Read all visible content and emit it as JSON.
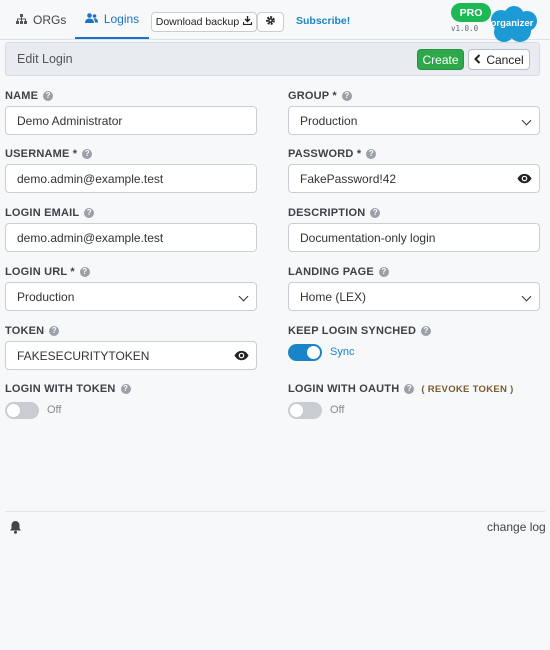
{
  "nav": {
    "tabs": [
      {
        "label": "ORGs",
        "icon": "sitemap-icon"
      },
      {
        "label": "Logins",
        "icon": "users-icon",
        "active": true
      }
    ],
    "download_backup_label": "Download backup",
    "subscribe_label": "Subscribe!",
    "pro_label": "PRO",
    "version": "v1.0.0",
    "logo_text": "organizer"
  },
  "header": {
    "title": "Edit Login",
    "create_label": "Create",
    "cancel_label": "Cancel"
  },
  "form": {
    "name": {
      "label": "NAME",
      "value": "Demo Administrator"
    },
    "group": {
      "label": "GROUP *",
      "value": "Production"
    },
    "username": {
      "label": "USERNAME *",
      "value": "demo.admin@example.test"
    },
    "password": {
      "label": "PASSWORD *",
      "value": "FakePassword!42"
    },
    "login_email": {
      "label": "LOGIN EMAIL",
      "value": "demo.admin@example.test"
    },
    "description": {
      "label": "DESCRIPTION",
      "value": "Documentation-only login"
    },
    "login_url": {
      "label": "LOGIN URL *",
      "value": "Production"
    },
    "landing_page": {
      "label": "LANDING PAGE",
      "value": "Home (LEX)"
    },
    "token": {
      "label": "TOKEN",
      "value": "FAKESECURITYTOKEN"
    },
    "keep_synched": {
      "label": "KEEP LOGIN SYNCHED",
      "state": "Sync",
      "on": true
    },
    "login_with_token": {
      "label": "LOGIN WITH TOKEN",
      "state": "Off",
      "on": false
    },
    "login_with_oauth": {
      "label": "LOGIN WITH OAUTH",
      "state": "Off",
      "on": false,
      "revoke_label": "( REVOKE TOKEN )"
    }
  },
  "footer": {
    "changelog_label": "change log"
  },
  "colors": {
    "accent": "#1b84c8",
    "create": "#2ea84a",
    "pro": "#1db954",
    "logo": "#1b9ad6"
  }
}
